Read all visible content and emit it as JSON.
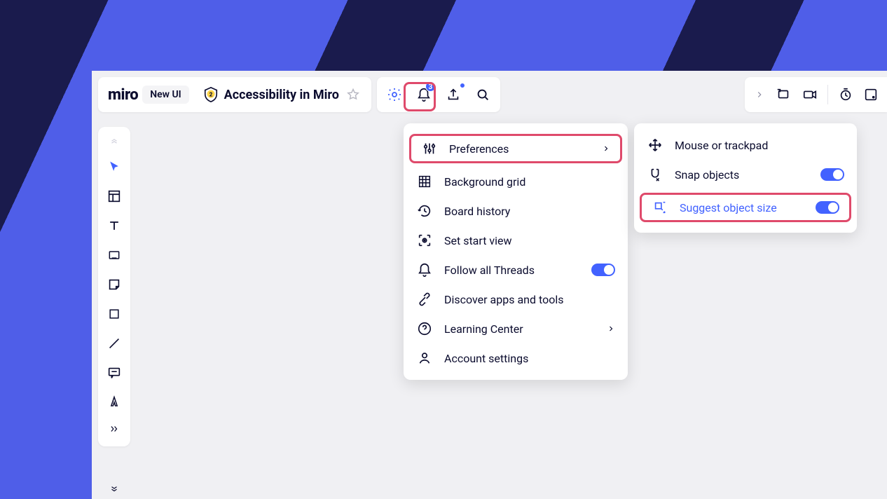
{
  "header": {
    "logo": "miro",
    "new_ui_label": "New UI",
    "shield_badge": "2",
    "board_title": "Accessibility in Miro",
    "notif_count": "3"
  },
  "settings_menu": {
    "items": [
      {
        "label": "Preferences",
        "has_sub": true
      },
      {
        "label": "Background grid"
      },
      {
        "label": "Board history"
      },
      {
        "label": "Set start view"
      },
      {
        "label": "Follow all Threads",
        "toggle": true
      },
      {
        "label": "Discover apps and tools"
      },
      {
        "label": "Learning Center",
        "has_sub": true
      },
      {
        "label": "Account settings"
      }
    ]
  },
  "preferences_submenu": {
    "items": [
      {
        "label": "Mouse or trackpad"
      },
      {
        "label": "Snap objects",
        "toggle": true
      },
      {
        "label": "Suggest object size",
        "toggle": true,
        "highlight": true
      }
    ]
  }
}
